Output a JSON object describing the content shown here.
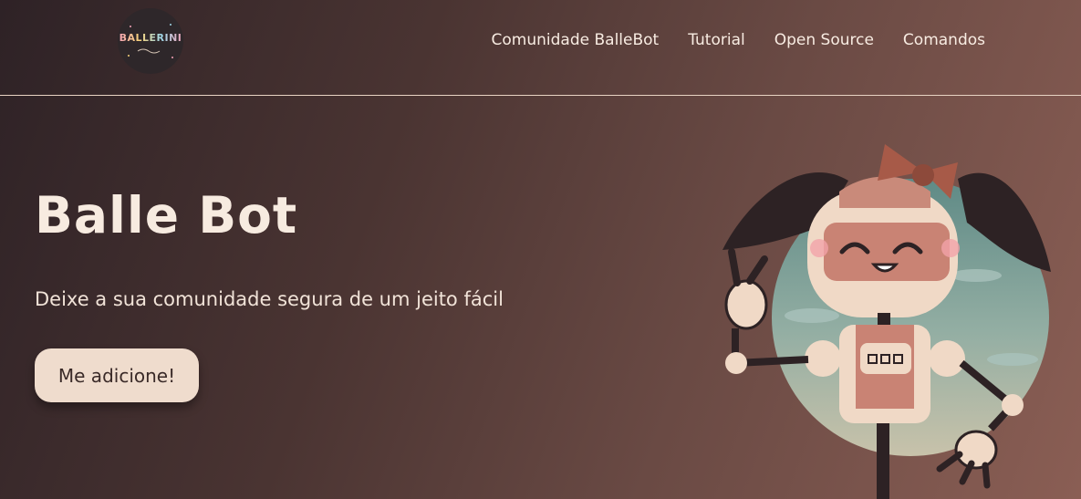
{
  "header": {
    "logo": {
      "text": "BALLERINI",
      "icon": "logo-icon"
    },
    "nav": [
      {
        "label": "Comunidade BalleBot"
      },
      {
        "label": "Tutorial"
      },
      {
        "label": "Open Source"
      },
      {
        "label": "Comandos"
      }
    ]
  },
  "hero": {
    "title": "Balle Bot",
    "subtitle": "Deixe a sua comunidade segura de um jeito fácil",
    "cta_label": "Me adicione!",
    "illustration": "robot-mascot-illustration"
  },
  "colors": {
    "bg_dark": "#2e2226",
    "bg_light": "#8a5e54",
    "button_bg": "#efdccd",
    "text_light": "#f7ebe0"
  }
}
